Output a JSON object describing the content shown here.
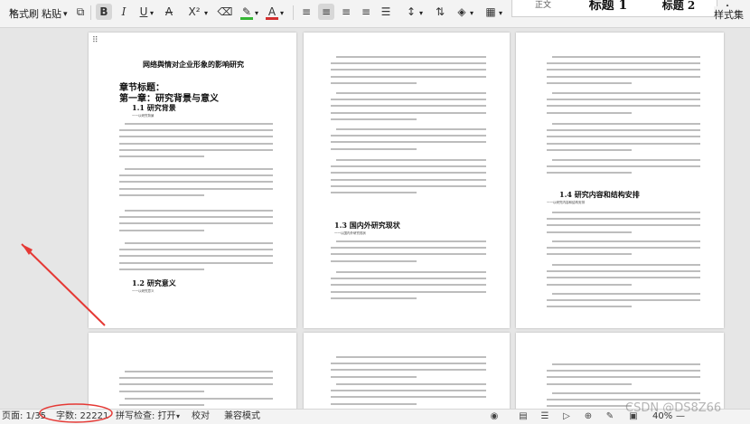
{
  "ribbon": {
    "format_painter": "格式刷",
    "paste": "粘贴",
    "paste_arrow": "▾",
    "bold": "B",
    "italic": "I",
    "underline": "U",
    "strikethrough": "A",
    "superscript": "X²",
    "styles": {
      "normal": "正文",
      "heading1": "标题 1",
      "heading2": "标题 2"
    },
    "style_set": "样式集"
  },
  "document": {
    "page1": {
      "title": "网络舆情对企业形象的影响研究",
      "chapter_label": "章节标题：",
      "chapter1": "第一章：研究背景与意义",
      "sec_1_1": "1.1 研究背景",
      "sec_1_1_note": "一一以研究背景",
      "sec_1_2": "1.2 研究意义",
      "sec_1_2_note": "一一以研究意义"
    },
    "page2": {
      "sec_1_3": "1.3 国内外研究现状",
      "sec_1_3_note": "一一以国内外研究现状"
    },
    "page3": {
      "sec_1_4": "1.4 研究内容和结构安排",
      "sec_1_4_note": "一一以研究内容和结构安排"
    }
  },
  "statusbar": {
    "page": "页面: 1/35",
    "word_count": "字数: 22221",
    "spellcheck": "拼写检查: 打开",
    "spellcheck_arrow": "▾",
    "proofread": "校对",
    "compat_mode": "兼容模式",
    "zoom": "40%",
    "zoom_minus": "—"
  },
  "watermark": "CSDN @DS8Z66",
  "colors": {
    "highlight": "#35b735",
    "font_color": "#d32f2f",
    "annotation": "#e53935"
  }
}
